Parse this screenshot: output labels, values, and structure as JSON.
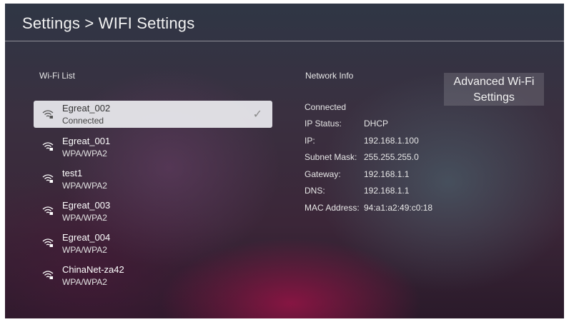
{
  "header": {
    "title": "Settings > WIFI Settings"
  },
  "wifi_list": {
    "label": "Wi-Fi List",
    "items": [
      {
        "name": "Egreat_002",
        "status": "Connected",
        "selected": true
      },
      {
        "name": "Egreat_001",
        "status": "WPA/WPA2",
        "selected": false
      },
      {
        "name": "test1",
        "status": "WPA/WPA2",
        "selected": false
      },
      {
        "name": "Egreat_003",
        "status": "WPA/WPA2",
        "selected": false
      },
      {
        "name": "Egreat_004",
        "status": "WPA/WPA2",
        "selected": false
      },
      {
        "name": "ChinaNet-za42",
        "status": "WPA/WPA2",
        "selected": false
      }
    ]
  },
  "network_info": {
    "label": "Network Info",
    "state": "Connected",
    "ip_status_label": "IP Status:",
    "ip_status": "DHCP",
    "ip_label": "IP:",
    "ip": "192.168.1.100",
    "subnet_label": "Subnet Mask:",
    "subnet": "255.255.255.0",
    "gateway_label": "Gateway:",
    "gateway": "192.168.1.1",
    "dns_label": "DNS:",
    "dns": "192.168.1.1",
    "mac_label": "MAC Address:",
    "mac": "94:a1:a2:49:c0:18"
  },
  "advanced": {
    "line1": "Advanced Wi-Fi",
    "line2": "Settings"
  },
  "icons": {
    "wifi": "wifi-lock-icon",
    "check": "checkmark-icon"
  }
}
